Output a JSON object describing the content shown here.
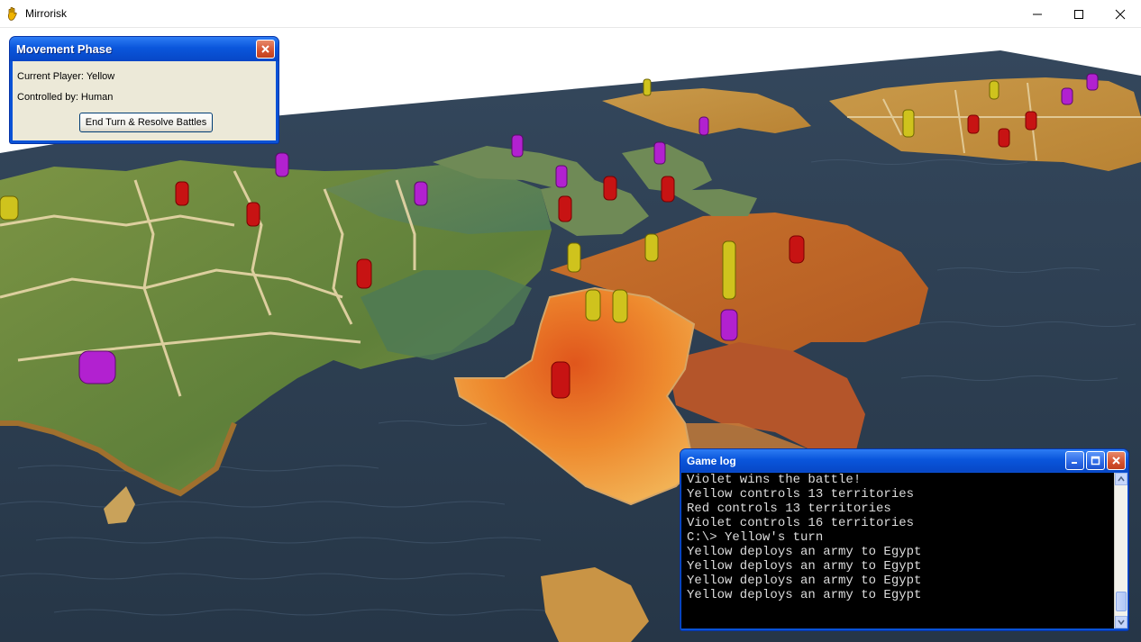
{
  "window": {
    "title": "Mirrorisk",
    "icon": "mirrorisk-hand-icon",
    "controls": [
      "minimize-icon",
      "maximize-icon",
      "close-icon"
    ]
  },
  "phase_panel": {
    "title": "Movement Phase",
    "current_player": "Current Player: Yellow",
    "controlled_by": "Controlled by: Human",
    "end_turn_button": "End Turn & Resolve Battles"
  },
  "game_log": {
    "title": "Game log",
    "lines": [
      "Violet wins the battle!",
      "Yellow controls 13 territories",
      "Red controls 13 territories",
      "Violet controls 16 territories",
      "C:\\> Yellow's turn",
      "Yellow deploys an army to Egypt",
      "Yellow deploys an army to Egypt",
      "Yellow deploys an army to Egypt",
      "Yellow deploys an army to Egypt"
    ]
  },
  "colors": {
    "yellow_player": "#d9d21e",
    "red_player": "#d41414",
    "violet_player": "#b11fd0",
    "ocean": "#2b3b4f",
    "xp_titlebar": "#0a56dc"
  }
}
